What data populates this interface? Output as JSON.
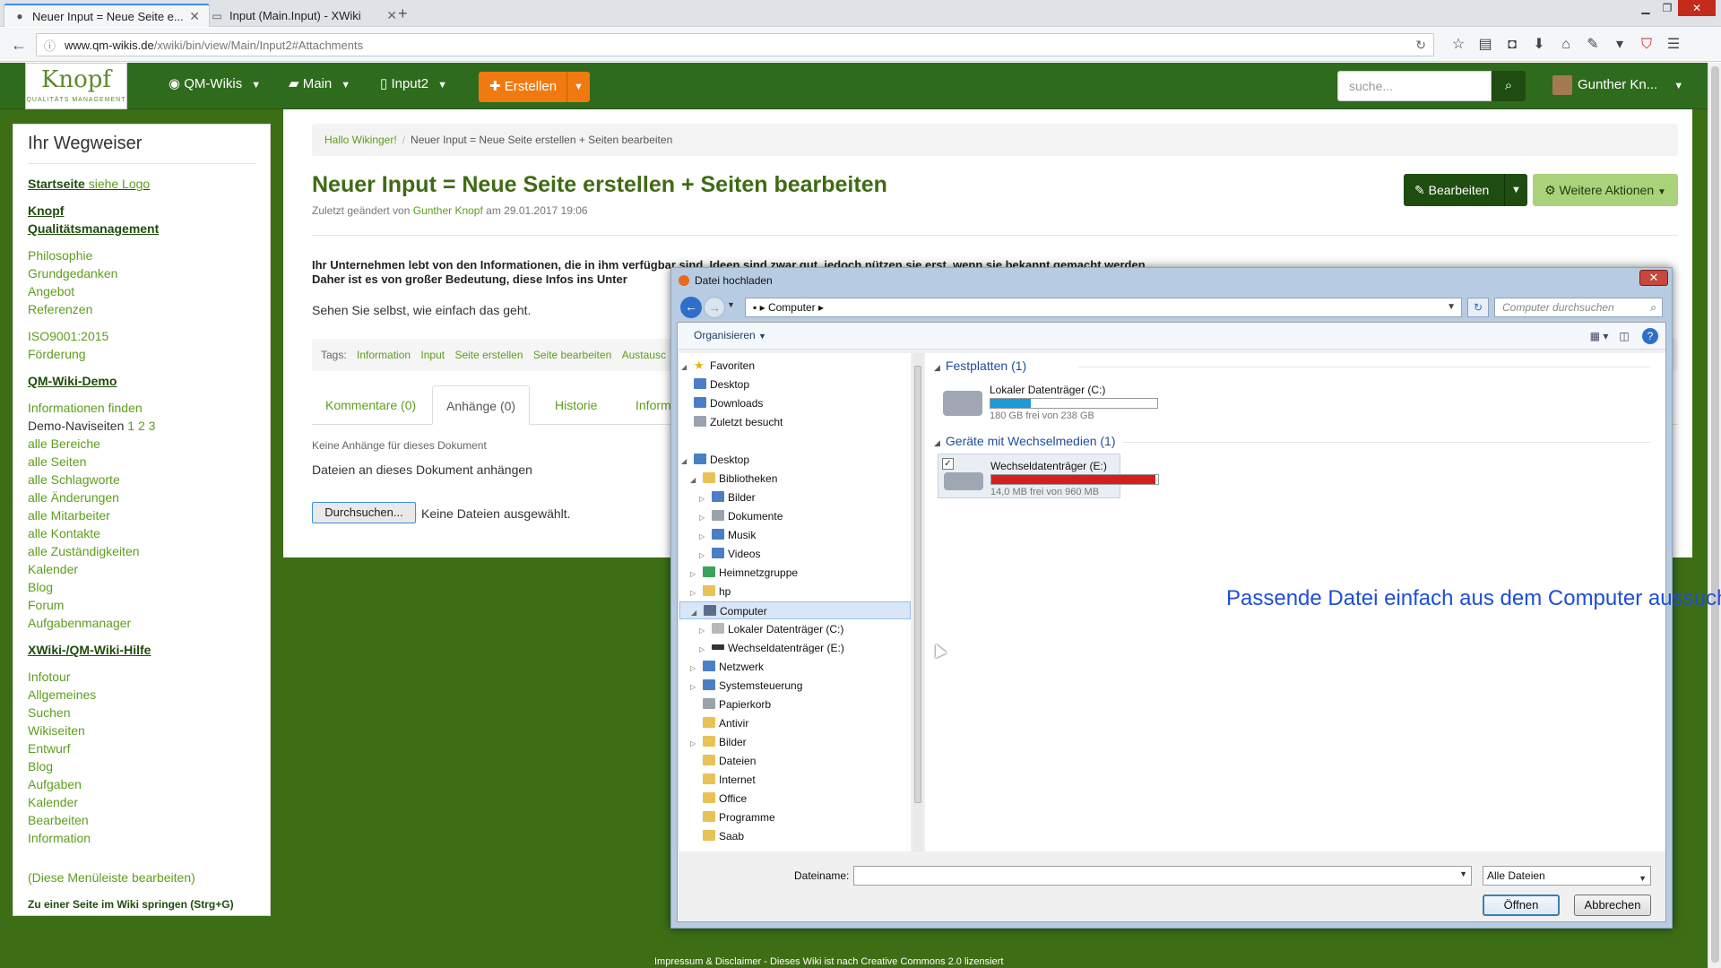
{
  "browser": {
    "tabs": [
      {
        "title": "Neuer Input = Neue Seite e...",
        "active": true
      },
      {
        "title": "Input (Main.Input) - XWiki",
        "active": false
      }
    ],
    "url_domain": "www.qm-wikis.de",
    "url_path": "/xwiki/bin/view/Main/Input2#Attachments"
  },
  "header": {
    "logo_text": "Knopf",
    "logo_sub": "QUALITÄTS MANAGEMENT",
    "menu": [
      "QM-Wikis",
      "Main",
      "Input2"
    ],
    "create_label": "Erstellen",
    "search_placeholder": "suche...",
    "user_name": "Gunther Kn..."
  },
  "sidebar": {
    "title": "Ihr Wegweiser",
    "startseite": "Startseite",
    "startseite_note": "siehe Logo",
    "knopf": "Knopf",
    "qm": "Qualitätsmanagement",
    "group1": [
      "Philosophie",
      "Grundgedanken",
      "Angebot",
      "Referenzen"
    ],
    "group2": [
      "ISO9001:2015",
      "Förderung"
    ],
    "demo_heading": "QM-Wiki-Demo",
    "info_finden": "Informationen finden",
    "demo_navi": "Demo-Naviseiten",
    "demo_navi_pages": "1 2 3",
    "group3": [
      "alle Bereiche",
      "alle Seiten",
      "alle Schlagworte",
      "alle Änderungen",
      "alle Mitarbeiter",
      "alle Kontakte",
      "alle Zuständigkeiten",
      "Kalender",
      "Blog",
      "Forum",
      "Aufgabenmanager"
    ],
    "help_heading": "XWiki-/QM-Wiki-Hilfe",
    "group4": [
      "Infotour",
      "Allgemeines",
      "Suchen",
      "Wikiseiten",
      "Entwurf",
      "Blog",
      "Aufgaben",
      "Kalender",
      "Bearbeiten",
      "Information"
    ],
    "edit_menu": "(Diese Menüleiste bearbeiten)",
    "jump": "Zu einer Seite im Wiki springen (Strg+G)"
  },
  "page": {
    "breadcrumb": [
      "Hallo Wikinger!",
      "Neuer Input = Neue Seite erstellen + Seiten bearbeiten"
    ],
    "title": "Neuer Input = Neue Seite erstellen + Seiten bearbeiten",
    "meta_prefix": "Zuletzt geändert von",
    "meta_author": "Gunther Knopf",
    "meta_date": "am 29.01.2017 19:06",
    "edit_label": "Bearbeiten",
    "more_actions": "Weitere Aktionen",
    "intro_line1": "Ihr Unternehmen lebt von den Informationen, die in ihm verfügbar sind. Ideen sind zwar gut, jedoch nützen sie erst, wenn sie bekannt gemacht werden.",
    "intro_line2": "Daher ist es von großer Bedeutung, diese Infos ins Unter",
    "para2": "Sehen Sie selbst, wie einfach das geht.",
    "tags_label": "Tags:",
    "tags": [
      "Information",
      "Input",
      "Seite erstellen",
      "Seite bearbeiten",
      "Austausc"
    ],
    "tabs": [
      "Kommentare (0)",
      "Anhänge (0)",
      "Historie",
      "Informat"
    ],
    "no_attachments": "Keine Anhänge für dieses Dokument",
    "attach_label": "Dateien an dieses Dokument anhängen",
    "browse_label": "Durchsuchen...",
    "no_file": "Keine Dateien ausgewählt.",
    "footer": "Impressum & Disclaimer - Dieses Wiki ist nach Creative Commons 2.0 lizensiert"
  },
  "dialog": {
    "title": "Datei hochladen",
    "address": "Computer",
    "search_placeholder": "Computer durchsuchen",
    "organize": "Organisieren",
    "tree": [
      {
        "label": "Favoriten",
        "icon": "star-icon"
      },
      {
        "label": "Desktop",
        "icon": "desktop-icon"
      },
      {
        "label": "Downloads",
        "icon": "downloads-icon"
      },
      {
        "label": "Zuletzt besucht",
        "icon": "recent-icon"
      },
      {
        "label": "Desktop",
        "icon": "desktop-icon"
      },
      {
        "label": "Bibliotheken",
        "icon": "library-icon"
      },
      {
        "label": "Bilder",
        "icon": "pictures-icon"
      },
      {
        "label": "Dokumente",
        "icon": "documents-icon"
      },
      {
        "label": "Musik",
        "icon": "music-icon"
      },
      {
        "label": "Videos",
        "icon": "videos-icon"
      },
      {
        "label": "Heimnetzgruppe",
        "icon": "homegroup-icon"
      },
      {
        "label": "hp",
        "icon": "user-folder-icon"
      },
      {
        "label": "Computer",
        "icon": "computer-icon"
      },
      {
        "label": "Lokaler Datenträger (C:)",
        "icon": "hard-drive-icon"
      },
      {
        "label": "Wechseldatenträger (E:)",
        "icon": "usb-drive-icon"
      },
      {
        "label": "Netzwerk",
        "icon": "network-icon"
      },
      {
        "label": "Systemsteuerung",
        "icon": "control-panel-icon"
      },
      {
        "label": "Papierkorb",
        "icon": "recycle-bin-icon"
      },
      {
        "label": "Antivir",
        "icon": "folder-icon"
      },
      {
        "label": "Bilder",
        "icon": "folder-icon"
      },
      {
        "label": "Dateien",
        "icon": "folder-icon"
      },
      {
        "label": "Internet",
        "icon": "folder-icon"
      },
      {
        "label": "Office",
        "icon": "folder-icon"
      },
      {
        "label": "Programme",
        "icon": "folder-icon"
      },
      {
        "label": "Saab",
        "icon": "folder-icon"
      }
    ],
    "group_hdd": "Festplatten (1)",
    "drive_c_name": "Lokaler Datenträger (C:)",
    "drive_c_free": "180 GB frei von 238 GB",
    "drive_c_used_fraction": 0.24,
    "group_removable": "Geräte mit Wechselmedien (1)",
    "drive_e_name": "Wechseldatenträger (E:)",
    "drive_e_free": "14,0 MB frei von 960 MB",
    "drive_e_used_fraction": 0.985,
    "annotation": "Passende Datei einfach aus dem Computer aussuchen",
    "filename_label": "Dateiname:",
    "filename_value": "",
    "filetype": "Alle Dateien",
    "open_label": "Öffnen",
    "cancel_label": "Abbrechen"
  },
  "colors": {
    "site_green": "#3d6e16",
    "link_green": "#5c9e1d",
    "accent_orange": "#f07a10",
    "annotation_blue": "#1d4ed8",
    "drive_c_bar": "#1c9bd6",
    "drive_e_bar": "#d41f1f"
  }
}
